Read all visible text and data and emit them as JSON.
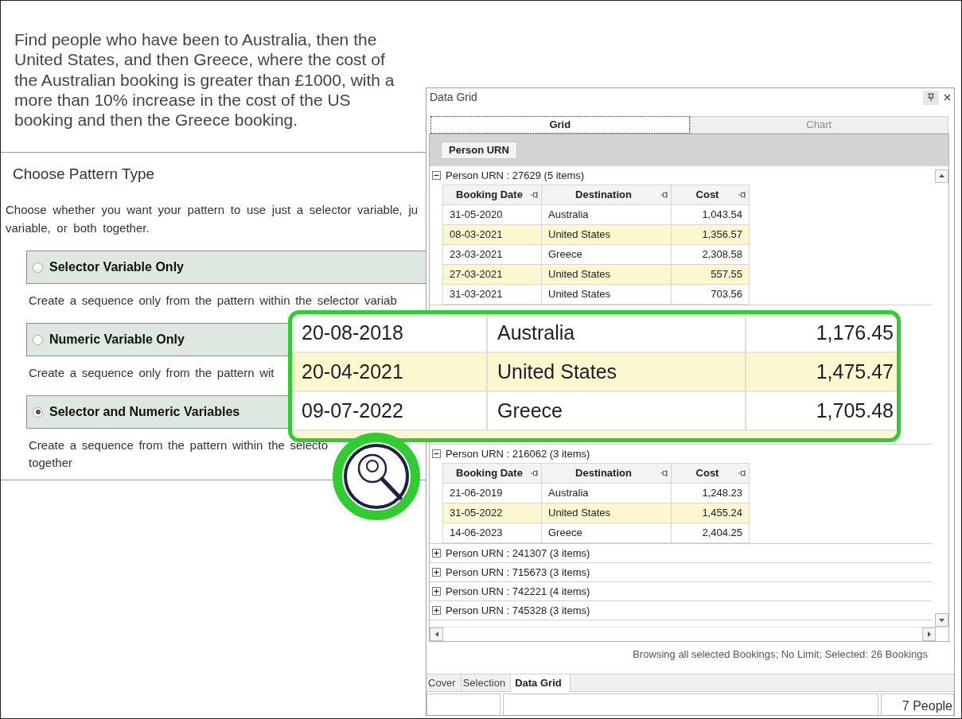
{
  "instruction": {
    "text": "Find people who have been to Australia, then the United States, and then Greece, where the cost of the Australian booking is greater than £1000, with a more than 10% increase in the cost of the US booking and then the Greece booking."
  },
  "pattern_panel": {
    "title": "Choose Pattern Type",
    "description_lines": [
      "Choose whether you want your pattern to use just a selector variable, ju",
      "variable, or both together."
    ],
    "options": [
      {
        "label": "Selector Variable Only",
        "selected": false,
        "description_lines": [
          "Create a sequence only from the pattern within the selector variab"
        ]
      },
      {
        "label": "Numeric Variable Only",
        "selected": false,
        "description_lines": [
          "Create a sequence only from the pattern wit"
        ]
      },
      {
        "label": "Selector and Numeric Variables",
        "selected": true,
        "description_lines": [
          "Create a sequence from the pattern within the selecto",
          "together"
        ]
      }
    ]
  },
  "data_grid_window": {
    "title": "Data Grid",
    "view_tabs": [
      {
        "label": "Grid",
        "selected": true,
        "disabled": false
      },
      {
        "label": "Chart",
        "selected": false,
        "disabled": true
      }
    ],
    "group_by": [
      "Person URN"
    ],
    "groups": [
      {
        "header": "Person URN : 27629 (5 items)",
        "expanded": true,
        "columns": [
          "Booking Date",
          "Destination",
          "Cost"
        ],
        "rows": [
          [
            "31-05-2020",
            "Australia",
            "1,043.54"
          ],
          [
            "08-03-2021",
            "United States",
            "1,356.57"
          ],
          [
            "23-03-2021",
            "Greece",
            "2,308.58"
          ],
          [
            "27-03-2021",
            "United States",
            "557.55"
          ],
          [
            "31-03-2021",
            "United States",
            "703.56"
          ]
        ]
      },
      {
        "header": "Person URN : 216062 (3 items)",
        "expanded": true,
        "columns": [
          "Booking Date",
          "Destination",
          "Cost"
        ],
        "rows": [
          [
            "21-06-2019",
            "Australia",
            "1,248.23"
          ],
          [
            "31-05-2022",
            "United States",
            "1,455.24"
          ],
          [
            "14-06-2023",
            "Greece",
            "2,404.25"
          ]
        ]
      },
      {
        "header": "Person URN : 241307 (3 items)",
        "expanded": false
      },
      {
        "header": "Person URN : 715673 (3 items)",
        "expanded": false
      },
      {
        "header": "Person URN : 742221 (4 items)",
        "expanded": false
      },
      {
        "header": "Person URN : 745328 (3 items)",
        "expanded": false
      }
    ],
    "status_text": "Browsing all selected Bookings; No Limit; Selected: 26 Bookings",
    "bottom_tabs": [
      {
        "label": "Cover",
        "selected": false
      },
      {
        "label": "Selection",
        "selected": false
      },
      {
        "label": "Data Grid",
        "selected": true
      }
    ],
    "status_bar": {
      "count": "7 People"
    }
  },
  "magnified_view": {
    "rows": [
      [
        "20-08-2018",
        "Australia",
        "1,176.45"
      ],
      [
        "20-04-2021",
        "United States",
        "1,475.47"
      ],
      [
        "09-07-2022",
        "Greece",
        "1,705.48"
      ]
    ]
  }
}
